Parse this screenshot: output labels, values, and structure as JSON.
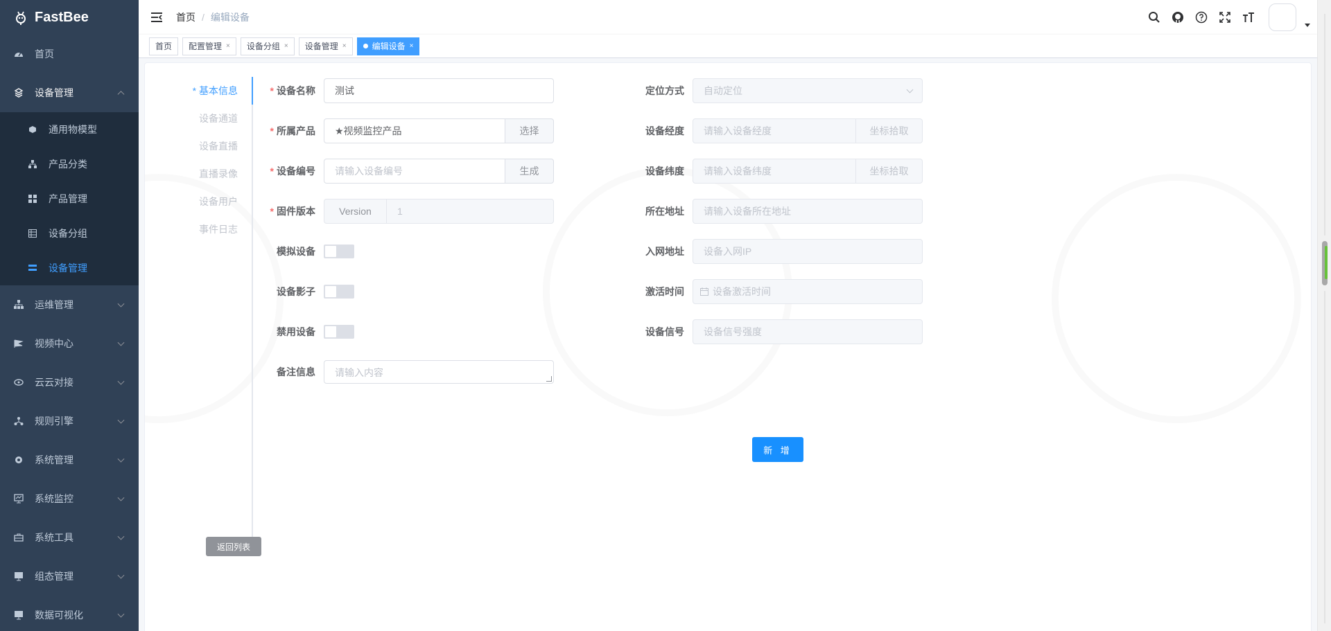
{
  "app": {
    "name": "FastBee"
  },
  "sidebar": {
    "items": [
      {
        "label": "首页",
        "icon": "dashboard-icon"
      },
      {
        "label": "设备管理",
        "icon": "device-icon",
        "open": true,
        "children": [
          {
            "label": "通用物模型",
            "icon": "cube-icon"
          },
          {
            "label": "产品分类",
            "icon": "tree-icon"
          },
          {
            "label": "产品管理",
            "icon": "grid-icon"
          },
          {
            "label": "设备分组",
            "icon": "group-icon"
          },
          {
            "label": "设备管理",
            "icon": "list-icon",
            "active": true
          }
        ]
      },
      {
        "label": "运维管理",
        "icon": "ops-icon"
      },
      {
        "label": "视频中心",
        "icon": "video-icon"
      },
      {
        "label": "云云对接",
        "icon": "cloud-icon"
      },
      {
        "label": "规则引擎",
        "icon": "rule-icon"
      },
      {
        "label": "系统管理",
        "icon": "gear-icon"
      },
      {
        "label": "系统监控",
        "icon": "monitor-icon"
      },
      {
        "label": "系统工具",
        "icon": "toolbox-icon"
      },
      {
        "label": "组态管理",
        "icon": "config-icon"
      },
      {
        "label": "数据可视化",
        "icon": "chart-icon"
      }
    ]
  },
  "header": {
    "breadcrumb": {
      "home": "首页",
      "separator": "/",
      "current": "编辑设备"
    }
  },
  "tags": [
    {
      "label": "首页",
      "closable": false,
      "active": false
    },
    {
      "label": "配置管理",
      "closable": true,
      "active": false
    },
    {
      "label": "设备分组",
      "closable": true,
      "active": false
    },
    {
      "label": "设备管理",
      "closable": true,
      "active": false
    },
    {
      "label": "编辑设备",
      "closable": true,
      "active": true
    }
  ],
  "tabs": {
    "items": [
      "基本信息",
      "设备通道",
      "设备直播",
      "直播录像",
      "设备用户",
      "事件日志"
    ],
    "active_prefix": "* ",
    "back_label": "返回列表"
  },
  "form": {
    "required_mark": "*",
    "device_name": {
      "label": "设备名称",
      "value": "测试"
    },
    "product": {
      "label": "所属产品",
      "value": "★视频监控产品",
      "button": "选择"
    },
    "serial": {
      "label": "设备编号",
      "placeholder": "请输入设备编号",
      "button": "生成"
    },
    "firmware": {
      "label": "固件版本",
      "prefix": "Version",
      "value": "1"
    },
    "simulate": {
      "label": "模拟设备",
      "on": false
    },
    "shadow": {
      "label": "设备影子",
      "on": false
    },
    "disable": {
      "label": "禁用设备",
      "on": false
    },
    "remark": {
      "label": "备注信息",
      "placeholder": "请输入内容"
    },
    "location_mode": {
      "label": "定位方式",
      "value": "自动定位"
    },
    "longitude": {
      "label": "设备经度",
      "placeholder": "请输入设备经度",
      "button": "坐标拾取"
    },
    "latitude": {
      "label": "设备纬度",
      "placeholder": "请输入设备纬度",
      "button": "坐标拾取"
    },
    "address": {
      "label": "所在地址",
      "placeholder": "请输入设备所在地址"
    },
    "network": {
      "label": "入网地址",
      "placeholder": "设备入网IP"
    },
    "activate": {
      "label": "激活时间",
      "placeholder": "设备激活时间"
    },
    "signal": {
      "label": "设备信号",
      "placeholder": "设备信号强度"
    },
    "submit": "新 增"
  },
  "colors": {
    "sidebar_bg": "#304156",
    "submenu_bg": "#1f2d3d",
    "accent": "#409eff",
    "primary_button": "#1890ff",
    "required": "#f56c6c"
  }
}
